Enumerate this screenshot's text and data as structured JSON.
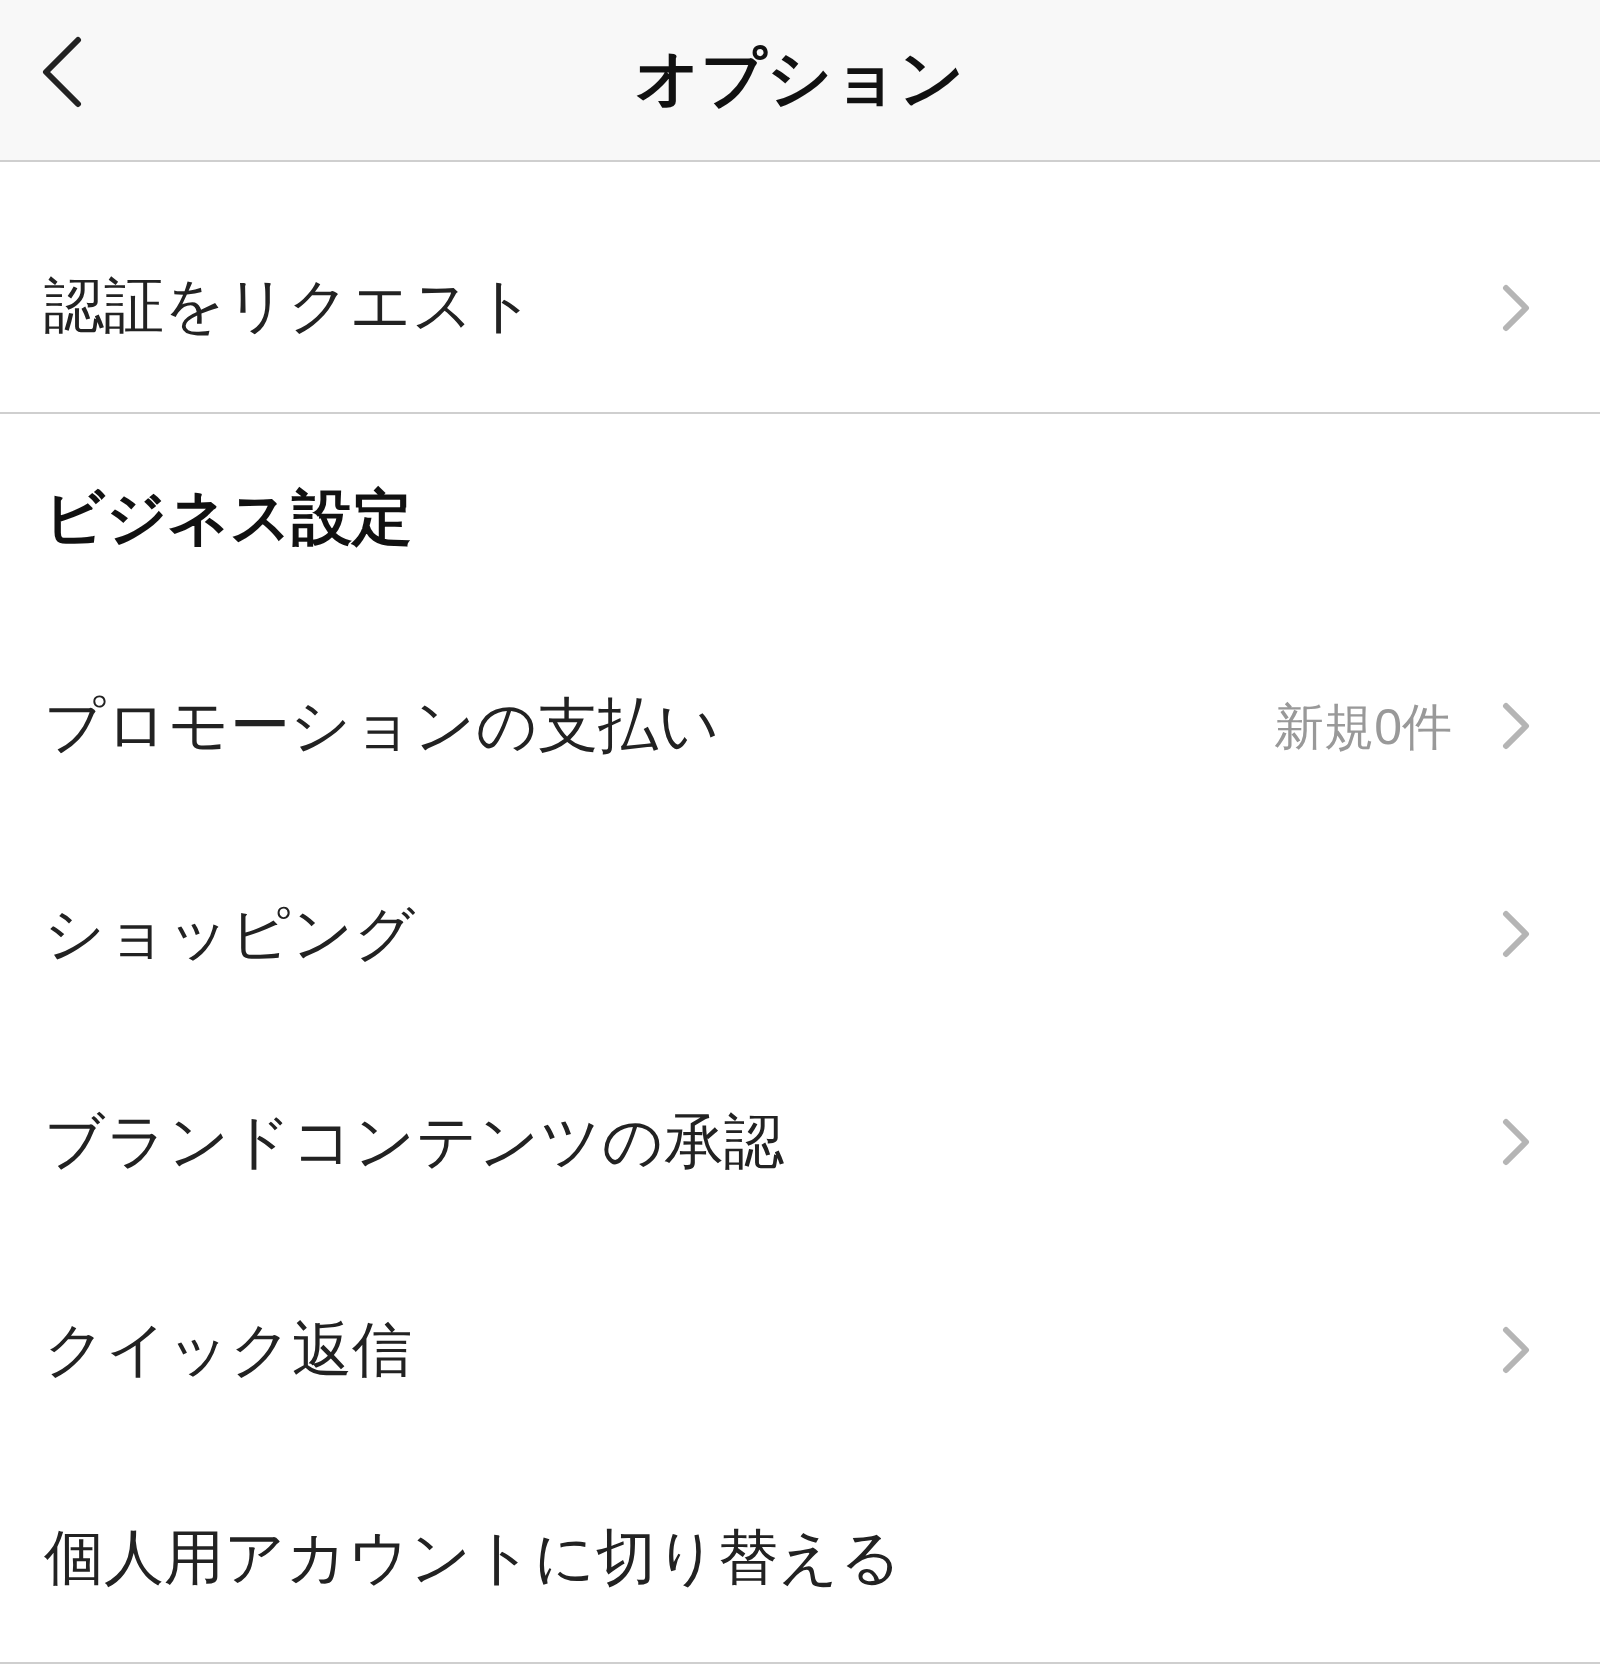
{
  "header": {
    "title": "オプション"
  },
  "top_item": {
    "label": "認証をリクエスト",
    "chevron": true
  },
  "section": {
    "title": "ビジネス設定",
    "items": [
      {
        "label": "プロモーションの支払い",
        "detail": "新規0件",
        "chevron": true
      },
      {
        "label": "ショッピング",
        "chevron": true
      },
      {
        "label": "ブランドコンテンツの承認",
        "chevron": true
      },
      {
        "label": "クイック返信",
        "chevron": true
      },
      {
        "label": "個人用アカウントに切り替える",
        "chevron": false
      }
    ]
  }
}
